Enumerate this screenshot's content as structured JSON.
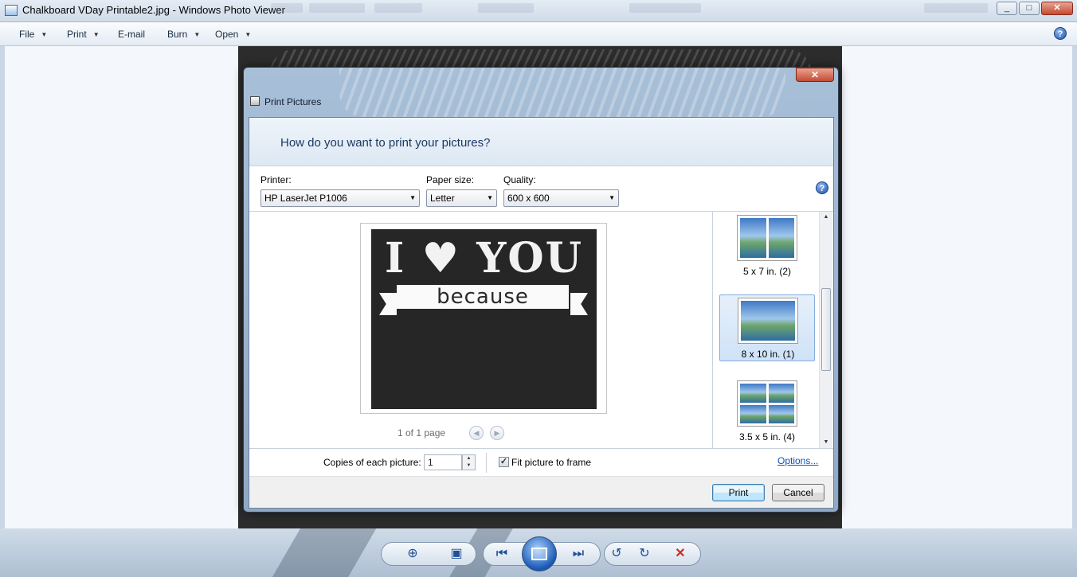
{
  "window": {
    "title": "Chalkboard VDay Printable2.jpg - Windows Photo Viewer",
    "buttons": [
      "_",
      "□",
      "✕"
    ]
  },
  "menu": {
    "file": "File",
    "print": "Print",
    "email": "E-mail",
    "burn": "Burn",
    "open": "Open",
    "help_icon": "?"
  },
  "dialog": {
    "title": "Print Pictures",
    "close_glyph": "✕",
    "question": "How do you want to print your pictures?",
    "printer_label": "Printer:",
    "printer_value": "HP LaserJet P1006",
    "paper_label": "Paper size:",
    "paper_value": "Letter",
    "quality_label": "Quality:",
    "quality_value": "600 x 600",
    "help_icon": "?",
    "preview": {
      "headline_left": "I",
      "heart": "♥",
      "headline_right": "YOU",
      "banner_word": "because"
    },
    "page_info": "1 of 1 page",
    "layouts": [
      {
        "label": "5 x 7 in. (2)"
      },
      {
        "label": "8 x 10 in. (1)",
        "selected": true
      },
      {
        "label": "3.5 x 5 in. (4)"
      }
    ],
    "copies_label": "Copies of each picture:",
    "copies_value": "1",
    "fit_label": "Fit picture to frame",
    "fit_checked": true,
    "options_link": "Options...",
    "print_button": "Print",
    "cancel_button": "Cancel"
  },
  "toolbar": {
    "icons": [
      "zoom-icon",
      "actual-size-icon",
      "previous-icon",
      "slideshow-icon",
      "next-icon",
      "rotate-counterclockwise-icon",
      "rotate-clockwise-icon",
      "delete-icon"
    ]
  },
  "colors": {
    "accent": "#1f56b4",
    "delete": "#d8281e",
    "link": "#0b56b8"
  }
}
